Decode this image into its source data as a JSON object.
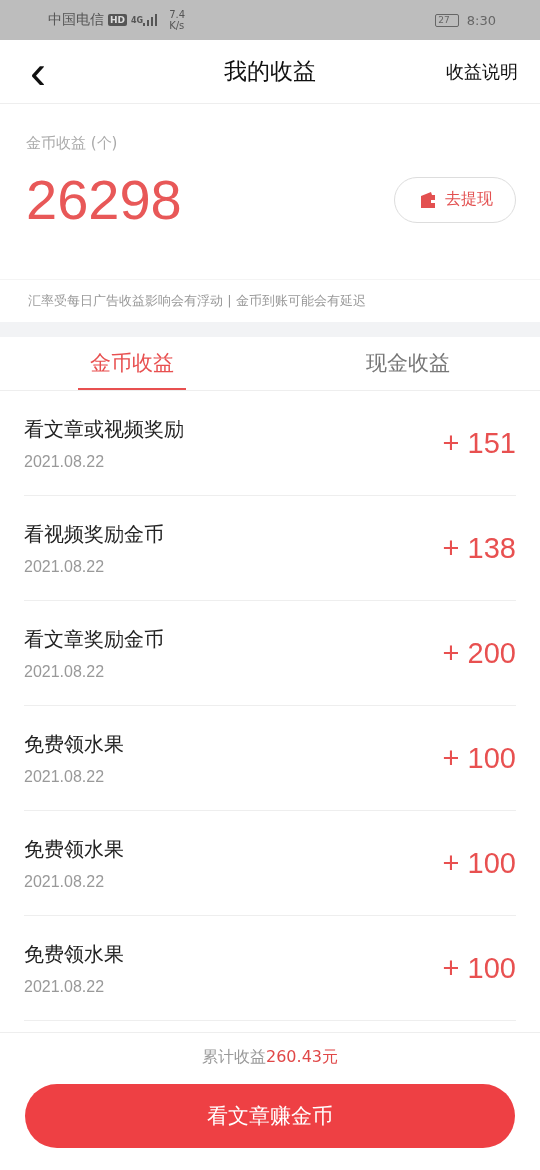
{
  "status_bar": {
    "carrier": "中国电信",
    "hd": "HD",
    "network": "4G",
    "speed_value": "7.4",
    "speed_unit": "K/s",
    "battery": "27",
    "time": "8:30"
  },
  "header": {
    "back": "‹",
    "title": "我的收益",
    "action": "收益说明"
  },
  "summary": {
    "label": "金币收益 (个)",
    "amount": "26298",
    "withdraw_button": "去提现"
  },
  "notice": "汇率受每日广告收益影响会有浮动 | 金币到账可能会有延迟",
  "tabs": [
    {
      "label": "金币收益",
      "selected": true
    },
    {
      "label": "现金收益",
      "selected": false
    }
  ],
  "records": [
    {
      "title": "看文章或视频奖励",
      "date": "2021.08.22",
      "amount": "+ 151"
    },
    {
      "title": "看视频奖励金币",
      "date": "2021.08.22",
      "amount": "+ 138"
    },
    {
      "title": "看文章奖励金币",
      "date": "2021.08.22",
      "amount": "+ 200"
    },
    {
      "title": "免费领水果",
      "date": "2021.08.22",
      "amount": "+ 100"
    },
    {
      "title": "免费领水果",
      "date": "2021.08.22",
      "amount": "+ 100"
    },
    {
      "title": "免费领水果",
      "date": "2021.08.22",
      "amount": "+ 100"
    }
  ],
  "footer": {
    "total_label": "累计收益",
    "total_value": "260.43元",
    "button": "看文章赚金币"
  }
}
